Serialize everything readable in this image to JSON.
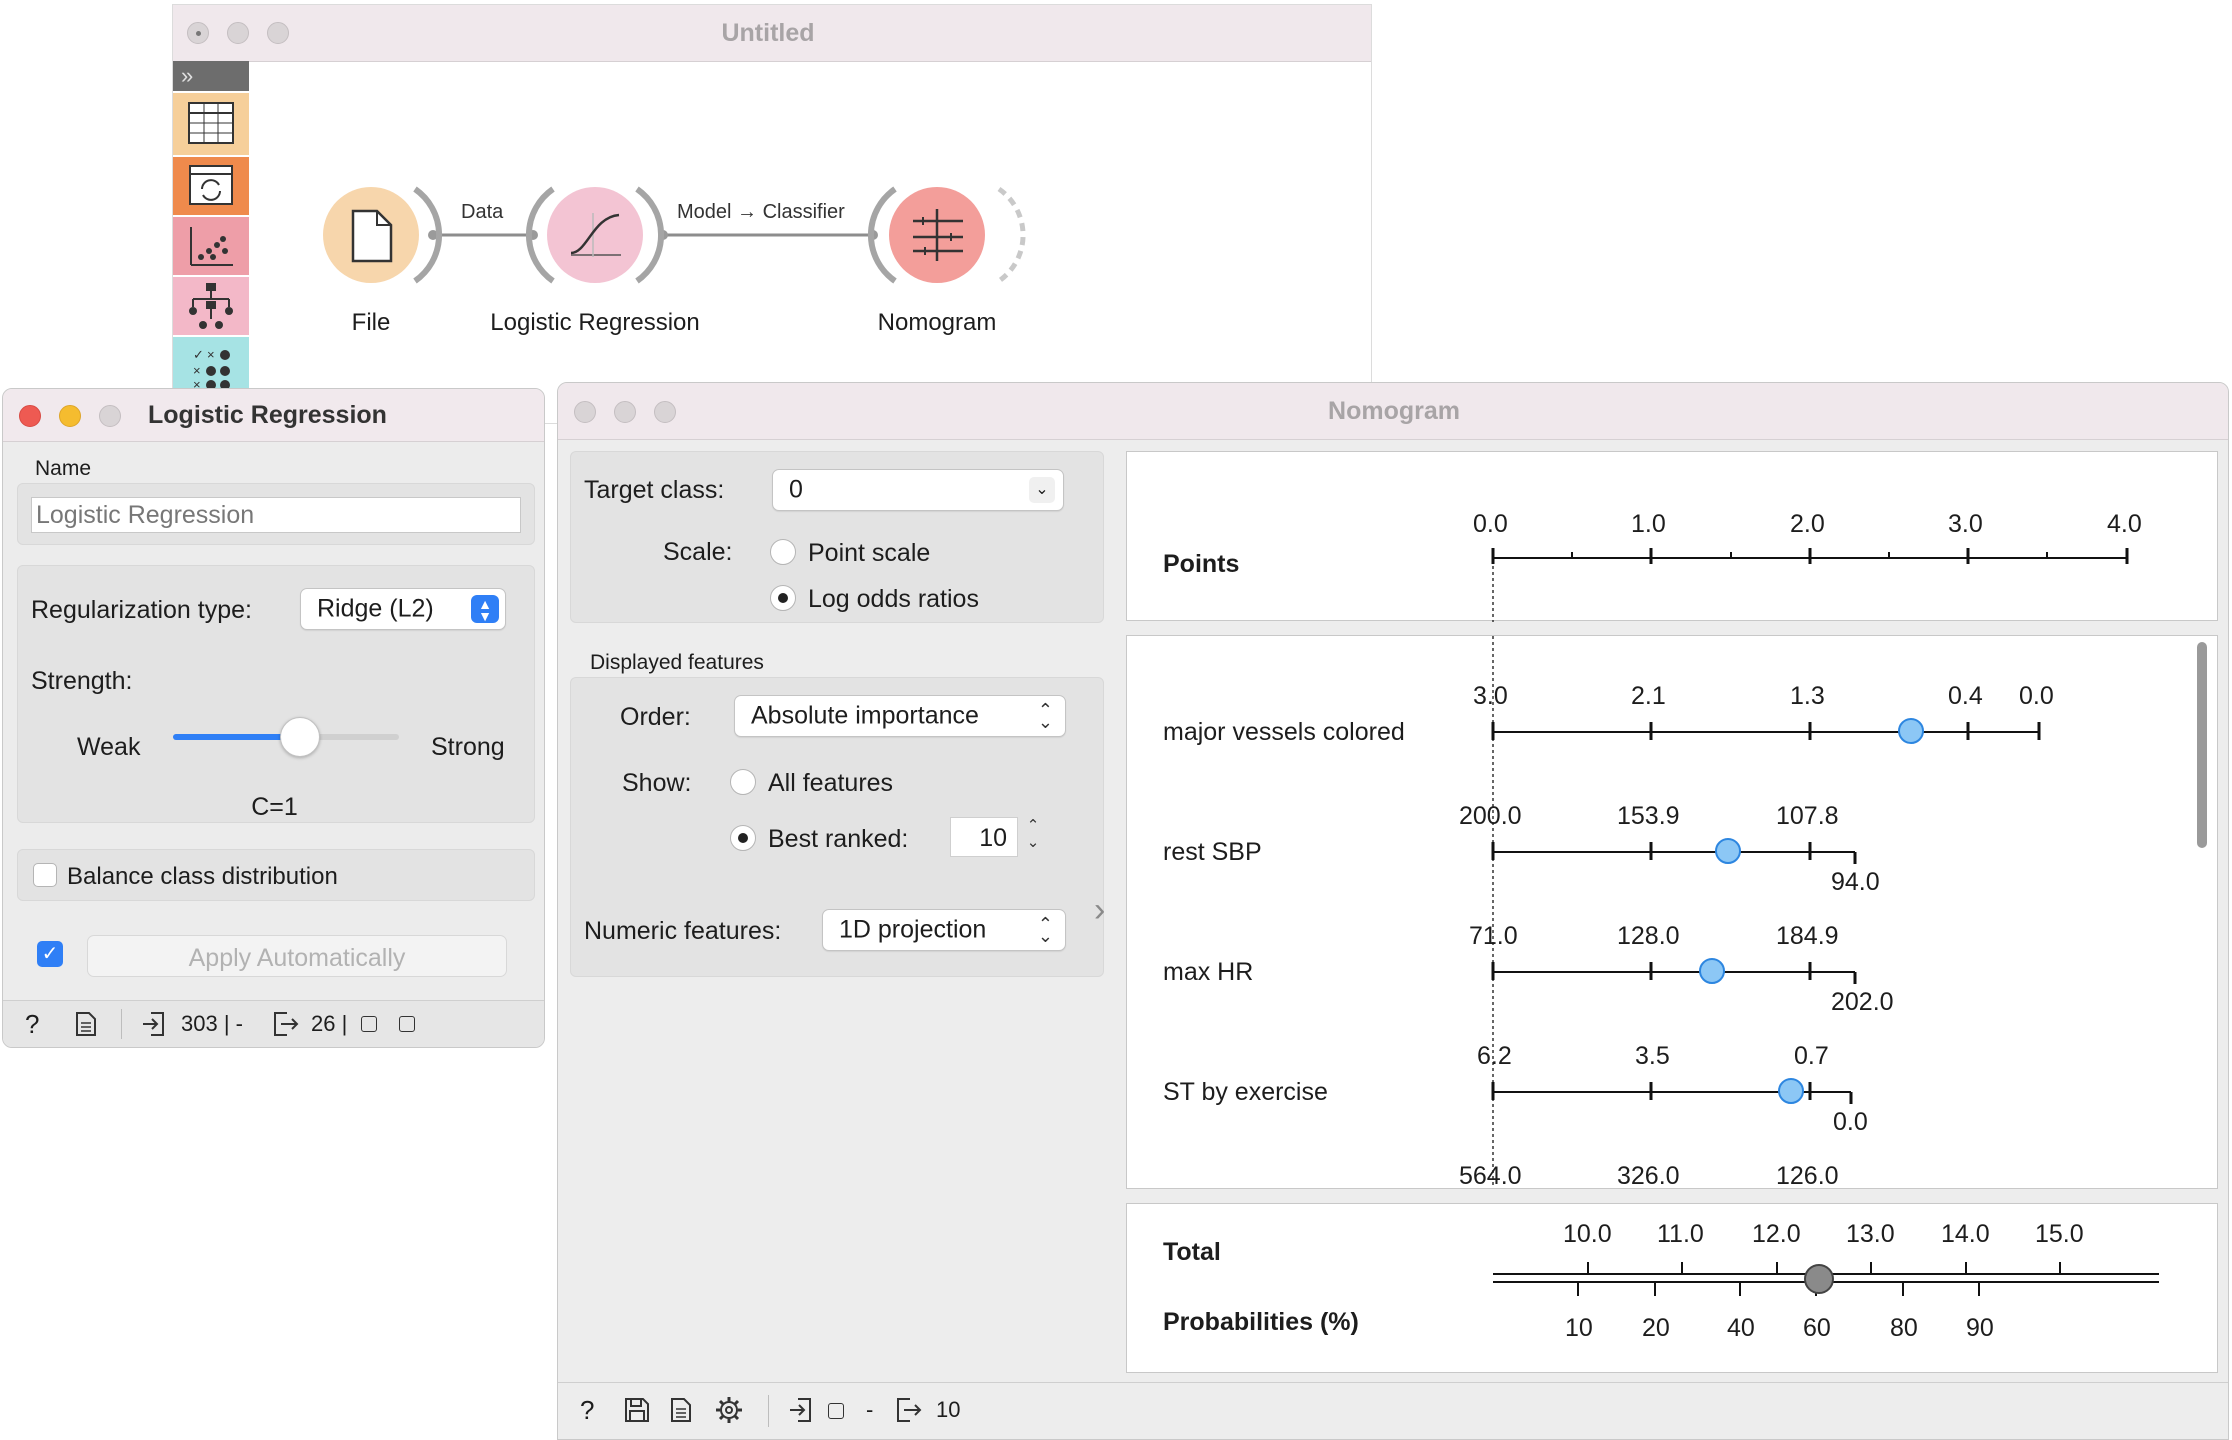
{
  "main_window": {
    "title": "Untitled",
    "nodes": [
      {
        "label": "File"
      },
      {
        "label": "Logistic Regression"
      },
      {
        "label": "Nomogram"
      }
    ],
    "links": [
      {
        "label": "Data"
      },
      {
        "label": "Model → Classifier"
      }
    ]
  },
  "lr_window": {
    "title": "Logistic Regression",
    "name_label": "Name",
    "name_value": "Logistic Regression",
    "regularization_label": "Regularization type:",
    "regularization_value": "Ridge (L2)",
    "strength_label": "Strength:",
    "weak_label": "Weak",
    "strong_label": "Strong",
    "strength_level": 0.56,
    "c_label": "C=1",
    "balance_label": "Balance class distribution",
    "balance_checked": false,
    "auto_checked": true,
    "apply_label": "Apply Automatically",
    "status": {
      "input_count": "303 | -",
      "output_count": "26 |"
    }
  },
  "nomogram_window": {
    "title": "Nomogram",
    "target_class_label": "Target class:",
    "target_class_value": "0",
    "scale_label": "Scale:",
    "scale_options": [
      "Point scale",
      "Log odds ratios"
    ],
    "scale_selected": 1,
    "displayed_features_label": "Displayed features",
    "order_label": "Order:",
    "order_value": "Absolute importance",
    "show_label": "Show:",
    "show_all_label": "All features",
    "show_best_label": "Best ranked:",
    "best_ranked_value": "10",
    "numeric_features_label": "Numeric features:",
    "numeric_features_value": "1D projection",
    "status": {
      "input_text": "-",
      "output_count": "10"
    },
    "points_label": "Points",
    "points_ticks": [
      "0.0",
      "1.0",
      "2.0",
      "3.0",
      "4.0"
    ],
    "features": [
      {
        "name": "major vessels colored",
        "labels_top": [
          "3.0",
          "2.1",
          "1.3",
          "0.4",
          "0.0"
        ],
        "labels_bottom": [],
        "marker": 0.66
      },
      {
        "name": "rest SBP",
        "labels_top": [
          "200.0",
          "153.9",
          "107.8"
        ],
        "labels_bottom": [
          "94.0"
        ],
        "marker": 0.37
      },
      {
        "name": "max HR",
        "labels_top": [
          "71.0",
          "128.0",
          "184.9"
        ],
        "labels_bottom": [
          "202.0"
        ],
        "marker": 0.345
      },
      {
        "name": "ST by exercise",
        "labels_top": [
          "6.2",
          "3.5",
          "0.7"
        ],
        "labels_bottom": [
          "0.0"
        ],
        "marker": 0.47
      }
    ],
    "partial_labels": [
      "564.0",
      "326.0",
      "126.0"
    ],
    "total_label": "Total",
    "total_ticks": [
      "10.0",
      "11.0",
      "12.0",
      "13.0",
      "14.0",
      "15.0"
    ],
    "probabilities_label": "Probabilities (%)",
    "prob_ticks": [
      "10",
      "20",
      "40",
      "60",
      "80",
      "90"
    ],
    "total_marker_value": 12.45
  }
}
